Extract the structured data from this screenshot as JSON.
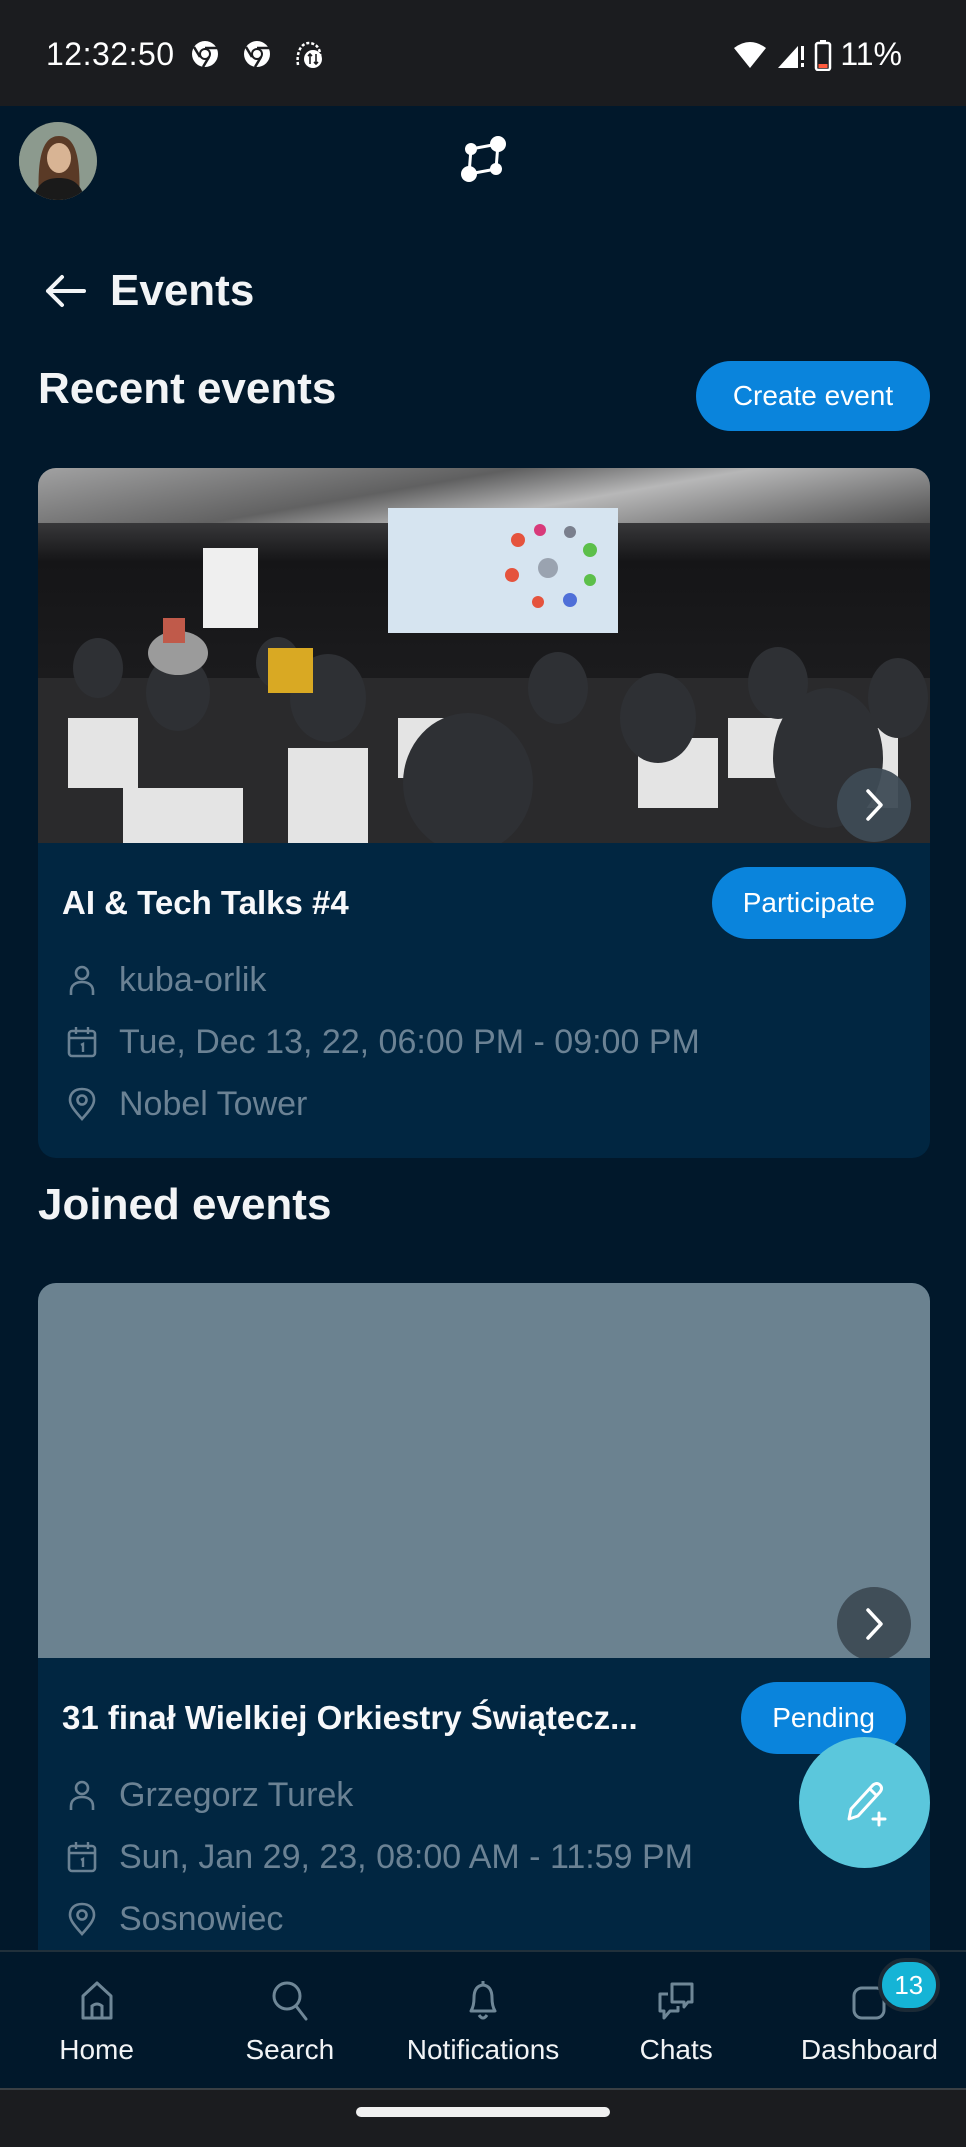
{
  "status_bar": {
    "time": "12:32:50",
    "left_icons": [
      "chrome-icon",
      "chrome-icon",
      "sync-notification-icon"
    ],
    "right_icons": [
      "wifi-icon",
      "signal-icon",
      "battery-low-icon"
    ],
    "battery": "11%"
  },
  "header": {
    "avatar_alt": "Profile picture",
    "logo": "app-logo-icon"
  },
  "page": {
    "title": "Events",
    "back_icon": "arrow-left-icon"
  },
  "recent": {
    "heading": "Recent events",
    "create_label": "Create event",
    "events": [
      {
        "title": "AI & Tech Talks #4",
        "action_label": "Participate",
        "organizer": "kuba-orlik",
        "datetime": "Tue, Dec 13, 22, 06:00 PM - 09:00 PM",
        "location": "Nobel Tower",
        "has_photo": true
      }
    ]
  },
  "joined": {
    "heading": "Joined events",
    "events": [
      {
        "title": "31 finał Wielkiej Orkiestry Świątecz...",
        "action_label": "Pending",
        "organizer": "Grzegorz Turek",
        "datetime": "Sun, Jan 29, 23, 08:00 AM - 11:59 PM",
        "location": "Sosnowiec",
        "has_photo": false
      }
    ]
  },
  "fab": {
    "icon": "pencil-plus-icon"
  },
  "bottom_nav": {
    "items": [
      {
        "label": "Home",
        "icon": "home-icon"
      },
      {
        "label": "Search",
        "icon": "search-icon"
      },
      {
        "label": "Notifications",
        "icon": "bell-icon"
      },
      {
        "label": "Chats",
        "icon": "chats-icon"
      },
      {
        "label": "Dashboard",
        "icon": "dashboard-icon",
        "badge": "13"
      }
    ]
  },
  "colors": {
    "background": "#01182b",
    "card": "#012641",
    "accent": "#0a84dc",
    "fab": "#5bc7dc",
    "badge": "#15b4d6",
    "meta_text": "#6b8294"
  }
}
